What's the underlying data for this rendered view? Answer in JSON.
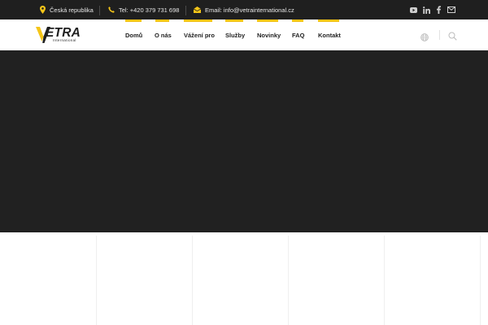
{
  "topbar": {
    "location": "Česká republika",
    "phone": "Tel: +420 379 731 698",
    "email": "Email: info@vetrainternational.cz",
    "social": [
      {
        "name": "youtube-icon"
      },
      {
        "name": "linkedin-icon"
      },
      {
        "name": "facebook-icon"
      },
      {
        "name": "email-icon"
      }
    ]
  },
  "brand": {
    "name": "ETRA",
    "tagline": "International"
  },
  "nav": {
    "items": [
      {
        "label": "Domů",
        "active": true
      },
      {
        "label": "O nás"
      },
      {
        "label": "Vážení pro"
      },
      {
        "label": "Služby"
      },
      {
        "label": "Novinky"
      },
      {
        "label": "FAQ"
      },
      {
        "label": "Kontakt"
      }
    ]
  },
  "colors": {
    "accent": "#f5c518",
    "topbar_bg": "#1f1f1f",
    "hero_bg": "#212121",
    "text_dark": "#222222"
  }
}
